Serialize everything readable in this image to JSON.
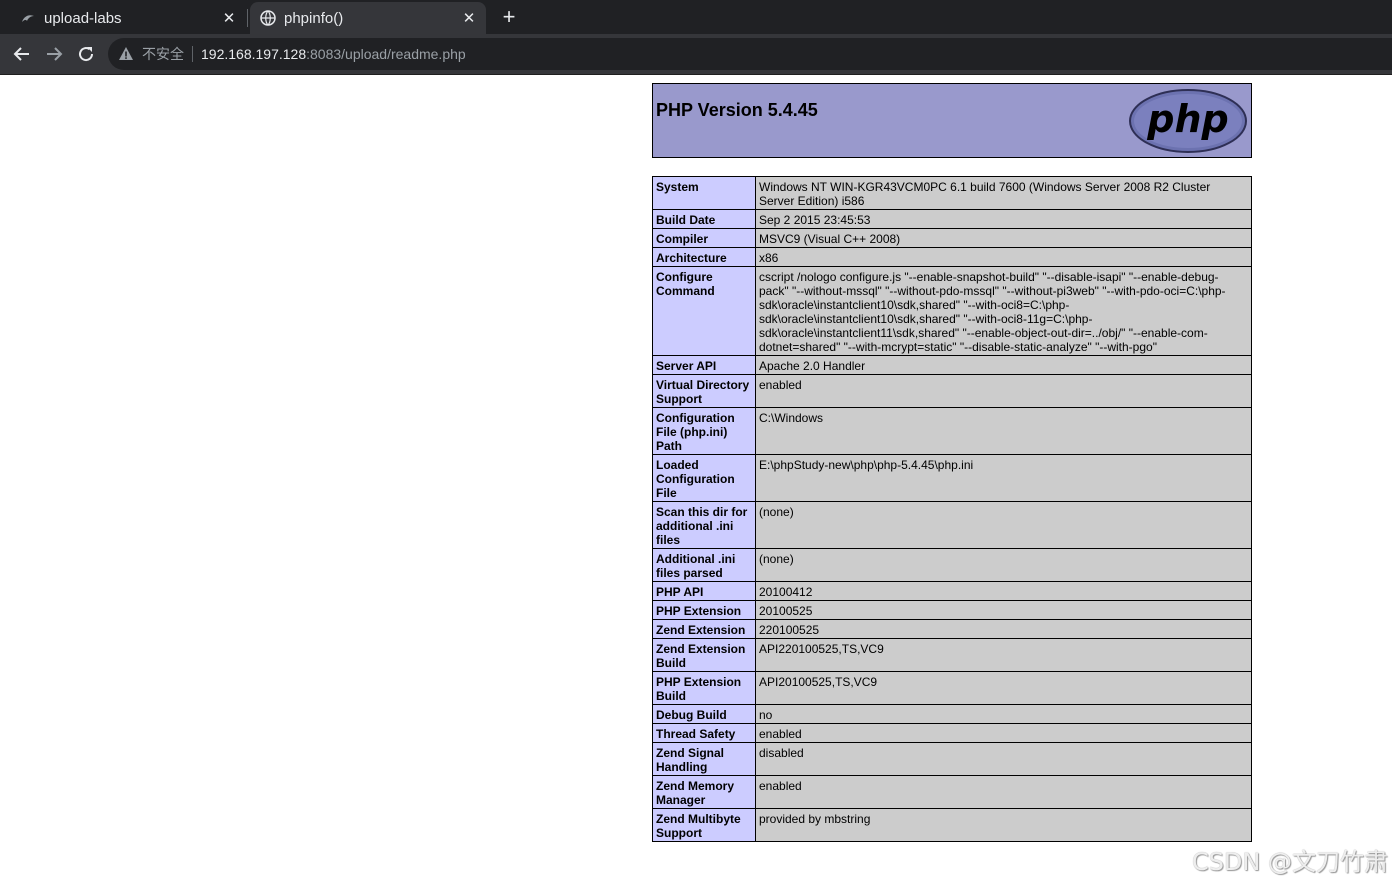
{
  "browser": {
    "tabs": [
      {
        "title": "upload-labs",
        "icon": "kali-dragon-icon",
        "active": false
      },
      {
        "title": "phpinfo()",
        "icon": "globe-icon",
        "active": true
      }
    ],
    "address": {
      "security_label": "不安全",
      "host": "192.168.197.128",
      "rest": ":8083/upload/readme.php"
    }
  },
  "phpinfo": {
    "title": "PHP Version 5.4.45",
    "logo_text": "php",
    "rows": [
      {
        "key": "System",
        "value": "Windows NT WIN-KGR43VCM0PC 6.1 build 7600 (Windows Server 2008 R2 Cluster Server Edition) i586"
      },
      {
        "key": "Build Date",
        "value": "Sep 2 2015 23:45:53"
      },
      {
        "key": "Compiler",
        "value": "MSVC9 (Visual C++ 2008)"
      },
      {
        "key": "Architecture",
        "value": "x86"
      },
      {
        "key": "Configure Command",
        "value": "cscript /nologo configure.js \"--enable-snapshot-build\" \"--disable-isapi\" \"--enable-debug-pack\" \"--without-mssql\" \"--without-pdo-mssql\" \"--without-pi3web\" \"--with-pdo-oci=C:\\php-sdk\\oracle\\instantclient10\\sdk,shared\" \"--with-oci8=C:\\php-sdk\\oracle\\instantclient10\\sdk,shared\" \"--with-oci8-11g=C:\\php-sdk\\oracle\\instantclient11\\sdk,shared\" \"--enable-object-out-dir=../obj/\" \"--enable-com-dotnet=shared\" \"--with-mcrypt=static\" \"--disable-static-analyze\" \"--with-pgo\""
      },
      {
        "key": "Server API",
        "value": "Apache 2.0 Handler"
      },
      {
        "key": "Virtual Directory Support",
        "value": "enabled"
      },
      {
        "key": "Configuration File (php.ini) Path",
        "value": "C:\\Windows"
      },
      {
        "key": "Loaded Configuration File",
        "value": "E:\\phpStudy-new\\php\\php-5.4.45\\php.ini"
      },
      {
        "key": "Scan this dir for additional .ini files",
        "value": "(none)"
      },
      {
        "key": "Additional .ini files parsed",
        "value": "(none)"
      },
      {
        "key": "PHP API",
        "value": "20100412"
      },
      {
        "key": "PHP Extension",
        "value": "20100525"
      },
      {
        "key": "Zend Extension",
        "value": "220100525"
      },
      {
        "key": "Zend Extension Build",
        "value": "API220100525,TS,VC9"
      },
      {
        "key": "PHP Extension Build",
        "value": "API20100525,TS,VC9"
      },
      {
        "key": "Debug Build",
        "value": "no"
      },
      {
        "key": "Thread Safety",
        "value": "enabled"
      },
      {
        "key": "Zend Signal Handling",
        "value": "disabled"
      },
      {
        "key": "Zend Memory Manager",
        "value": "enabled"
      },
      {
        "key": "Zend Multibyte Support",
        "value": "provided by mbstring"
      }
    ]
  },
  "watermark": "CSDN @文刀竹肃"
}
